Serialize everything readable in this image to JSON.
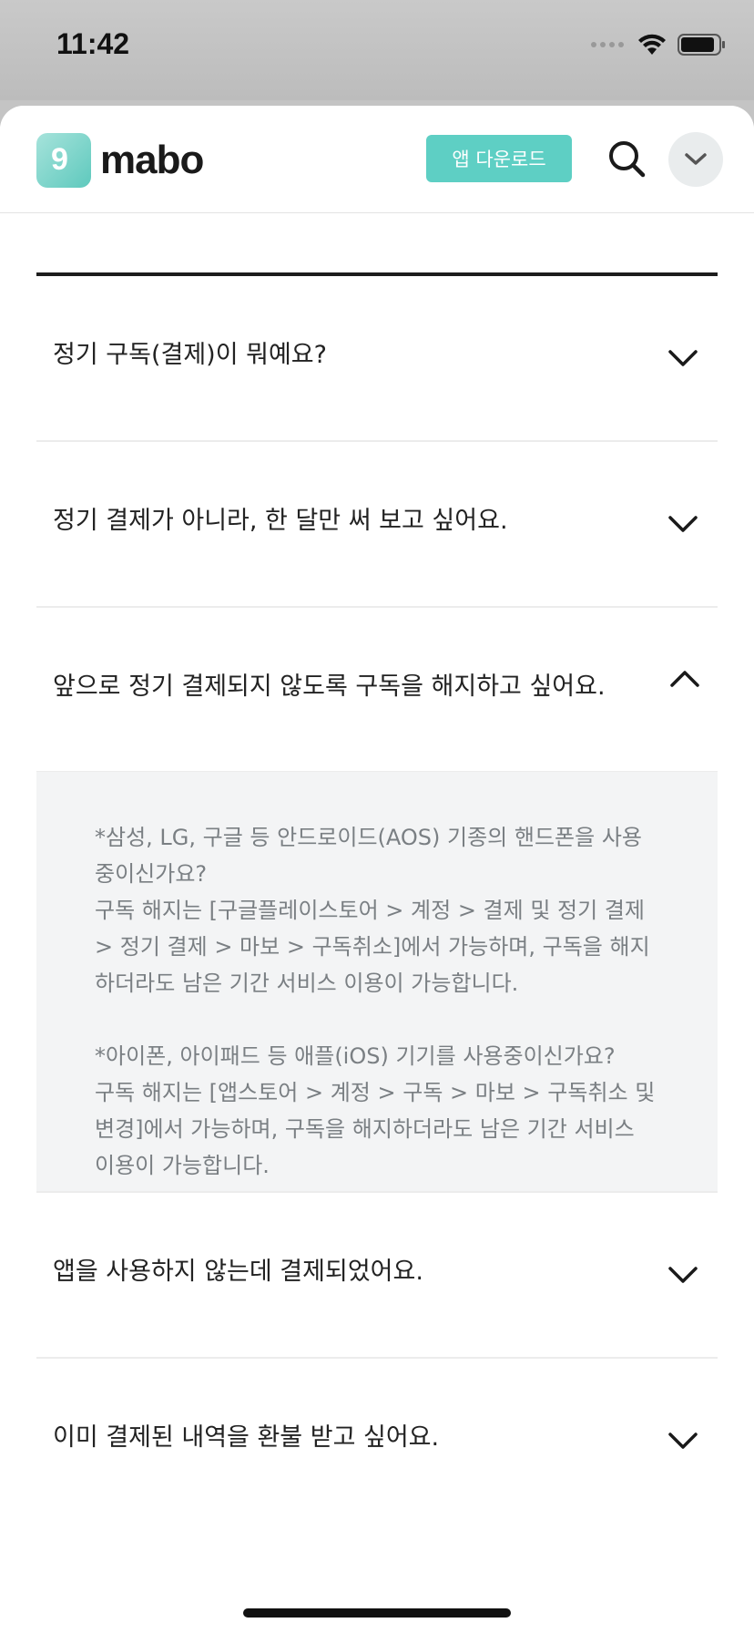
{
  "status_bar": {
    "time": "11:42"
  },
  "header": {
    "logo_mark": "9",
    "logo_text": "mabo",
    "download_label": "앱 다운로드"
  },
  "faq": {
    "items": [
      {
        "question": "정기 구독(결제)이 뭐예요?",
        "expanded": false
      },
      {
        "question": "정기 결제가 아니라, 한 달만 써 보고 싶어요.",
        "expanded": false
      },
      {
        "question": "앞으로 정기 결제되지 않도록 구독을 해지하고 싶어요.",
        "expanded": true
      },
      {
        "question": "앱을 사용하지 않는데 결제되었어요.",
        "expanded": false
      },
      {
        "question": "이미 결제된 내역을 환불 받고 싶어요.",
        "expanded": false
      }
    ],
    "answer_paragraph_1": "*삼성, LG, 구글 등 안드로이드(AOS) 기종의 핸드폰을 사용중이신가요?\n구독 해지는 [구글플레이스토어 > 계정 > 결제 및 정기 결제 > 정기 결제 > 마보 > 구독취소]에서 가능하며, 구독을 해지하더라도 남은 기간 서비스 이용이 가능합니다.",
    "answer_paragraph_2": "*아이폰, 아이패드 등 애플(iOS) 기기를 사용중이신가요?\n구독 해지는 [앱스토어 > 계정 > 구독 > 마보 > 구독취소 및 변경]에서 가능하며, 구독을 해지하더라도 남은 기간 서비스 이용이 가능합니다."
  },
  "icons": [
    "wifi-icon",
    "battery-icon",
    "signal-icon",
    "search-icon",
    "chevron-down-icon",
    "chevron-up-icon"
  ],
  "colors": {
    "accent": "#5ecfc4",
    "answer_bg": "#f3f4f5",
    "rule": "#1d1d1d"
  }
}
